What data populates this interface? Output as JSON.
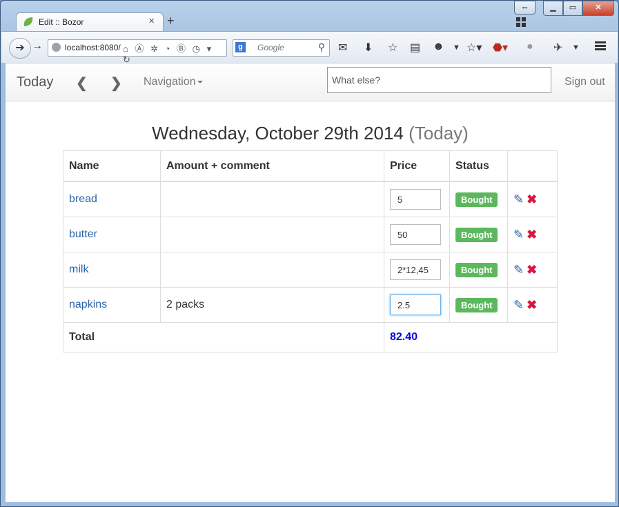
{
  "browser": {
    "tab_title": "Edit :: Bozor",
    "tab_close": "×",
    "new_tab": "+",
    "url": "localhost:8080/",
    "search_placeholder": "Google",
    "window_buttons": {
      "minimize": "▁",
      "maximize": "▭",
      "close": "✕"
    },
    "icons": [
      "back-icon",
      "forward-icon",
      "globe-icon",
      "home-icon",
      "angularjs-icon",
      "jenkins-icon",
      "jetbrains-icon",
      "bootstrap-icon",
      "history-icon",
      "reload-icon",
      "google-icon",
      "search-icon",
      "addon-icon",
      "download-icon",
      "bookmark-star-icon",
      "reading-list-icon",
      "avatar-icon",
      "abp-icon",
      "ghostery-icon",
      "spy-icon",
      "menu-icon"
    ]
  },
  "app": {
    "brand": "Today",
    "prev_arrow": "❮",
    "next_arrow": "❯",
    "navigation_label": "Navigation",
    "what_else_placeholder": "What else?",
    "sign_out": "Sign out"
  },
  "heading": {
    "date": "Wednesday, October 29th 2014",
    "today_label": "(Today)"
  },
  "table": {
    "headers": {
      "name": "Name",
      "amount": "Amount + comment",
      "price": "Price",
      "status": "Status"
    },
    "rows": [
      {
        "name": "bread",
        "amount": "",
        "price": "5",
        "status": "Bought"
      },
      {
        "name": "butter",
        "amount": "",
        "price": "50",
        "status": "Bought"
      },
      {
        "name": "milk",
        "amount": "",
        "price": "2*12,45",
        "status": "Bought"
      },
      {
        "name": "napkins",
        "amount": "2 packs",
        "price": "2.5",
        "status": "Bought"
      }
    ],
    "total_label": "Total",
    "total_value": "82.40"
  },
  "colors": {
    "status_bought": "#5cb85c",
    "link": "#2a64ad",
    "delete": "#d9173f",
    "total": "#0000ee"
  }
}
